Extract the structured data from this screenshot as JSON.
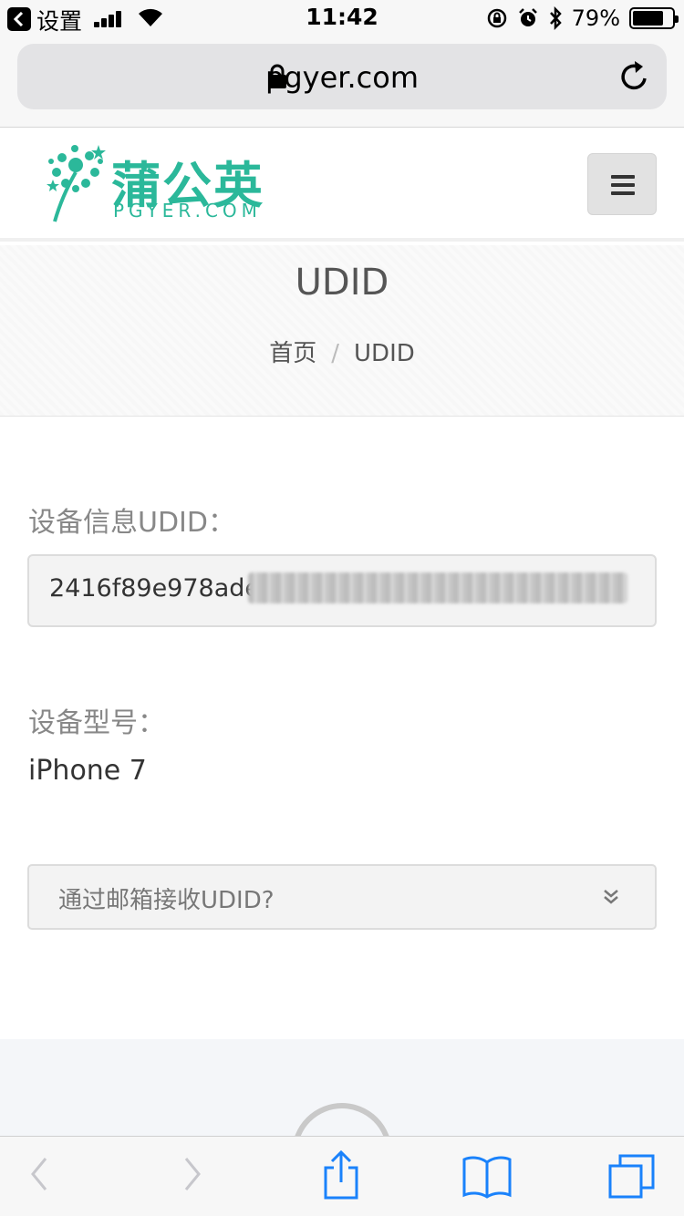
{
  "status_bar": {
    "back_label": "设置",
    "time": "11:42",
    "battery_percent": "79%",
    "battery_level": 0.79
  },
  "browser": {
    "url": "pgyer.com"
  },
  "site": {
    "logo_cn": "蒲公英",
    "logo_en": "PGYER.COM"
  },
  "hero": {
    "title": "UDID",
    "breadcrumb": {
      "home": "首页",
      "separator": "/",
      "current": "UDID"
    }
  },
  "udid_section": {
    "label": "设备信息UDID：",
    "value_visible": "2416f89e978ade"
  },
  "model_section": {
    "label": "设备型号：",
    "value": "iPhone 7"
  },
  "email_accordion": {
    "label": "通过邮箱接收UDID?"
  },
  "colors": {
    "brand": "#2bb89a",
    "ios_blue": "#1a82fb",
    "toolbar_disabled": "#c7c7cc"
  }
}
